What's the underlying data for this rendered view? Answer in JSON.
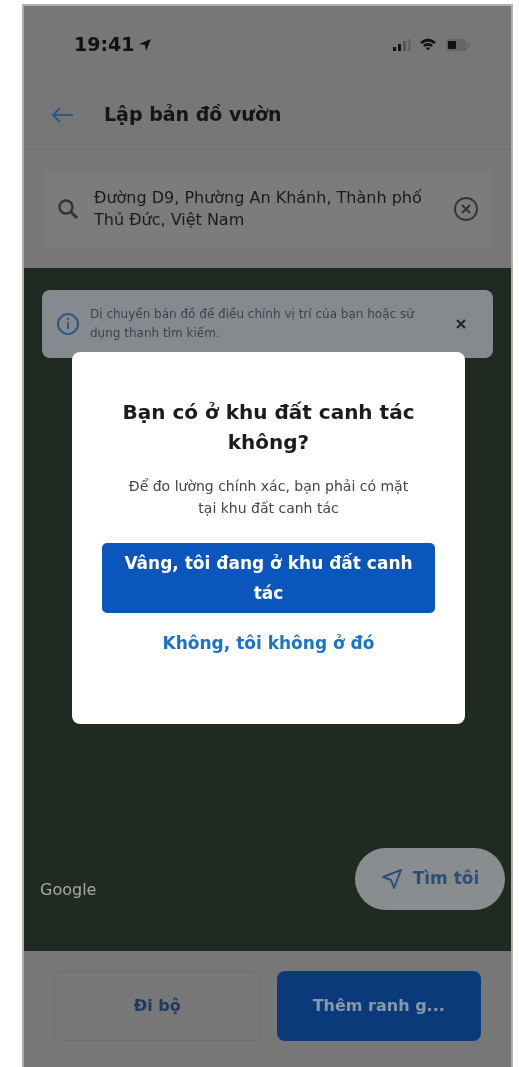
{
  "status_bar": {
    "time": "19:41"
  },
  "header": {
    "title": "Lập bản đồ vườn"
  },
  "search": {
    "value": "Đường D9, Phường An Khánh, Thành phố Thủ Đức, Việt Nam"
  },
  "info_banner": {
    "text": "Di chuyển bản đồ để điều chỉnh vị trí của bạn hoặc sử dụng thanh tìm kiếm."
  },
  "map": {
    "attribution": "Google",
    "locate_button": "Tìm tôi"
  },
  "dialog": {
    "title": "Bạn có ở khu đất canh tác không?",
    "message": "Để đo lường chính xác, bạn phải có mặt tại khu đất canh tác",
    "primary_button": "Vâng, tôi đang ở khu đất canh tác",
    "secondary_button": "Không, tôi không ở đó"
  },
  "bottom_buttons": [
    {
      "label": "Đi bộ",
      "kind": "outline"
    },
    {
      "label": "Thêm ranh g...",
      "kind": "primary"
    }
  ]
}
